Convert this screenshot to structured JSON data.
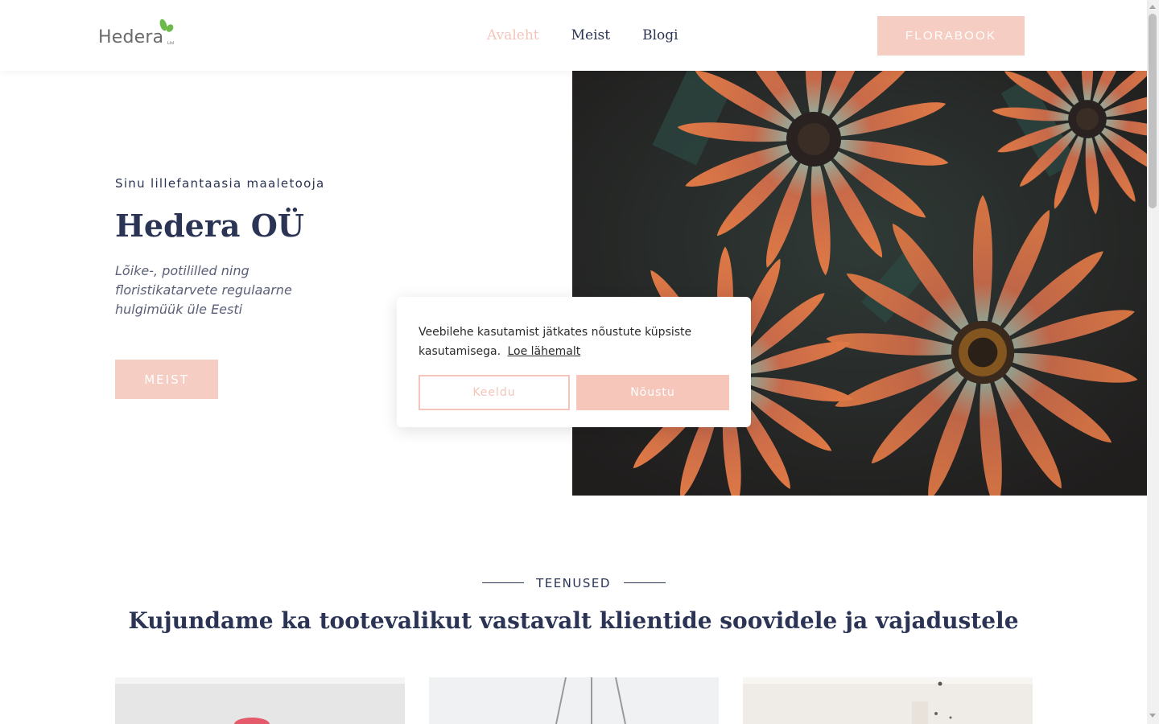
{
  "header": {
    "logo_text": "Hedera",
    "logo_sub": "Ltd",
    "nav": [
      {
        "label": "Avaleht",
        "active": true
      },
      {
        "label": "Meist",
        "active": false
      },
      {
        "label": "Blogi",
        "active": false
      }
    ],
    "cta_label": "FLORABOOK"
  },
  "hero": {
    "kicker": "Sinu lillefantaasia maaletooja",
    "title": "Hedera OÜ",
    "description": "Lõike-, potililled ning floristikatarvete regulaarne hulgimüük üle Eesti",
    "button_label": "MEIST"
  },
  "cookie": {
    "text": "Veebilehe kasutamist jätkates nõustute küpsiste kasutamisega.",
    "link_label": "Loe lähemalt",
    "decline_label": "Keeldu",
    "accept_label": "Nõustu"
  },
  "services": {
    "kicker": "TEENUSED",
    "title": "Kujundame ka tootevalikut vastavalt klientide soovidele ja vajadustele"
  },
  "colors": {
    "accent": "#f6cdc3",
    "text_dark": "#2b3454",
    "logo_green": "#6cbb4a"
  },
  "icons": {
    "logo_leaf": "leaf-icon",
    "scroll_up": "chevron-up-icon",
    "scroll_down": "chevron-down-icon"
  }
}
